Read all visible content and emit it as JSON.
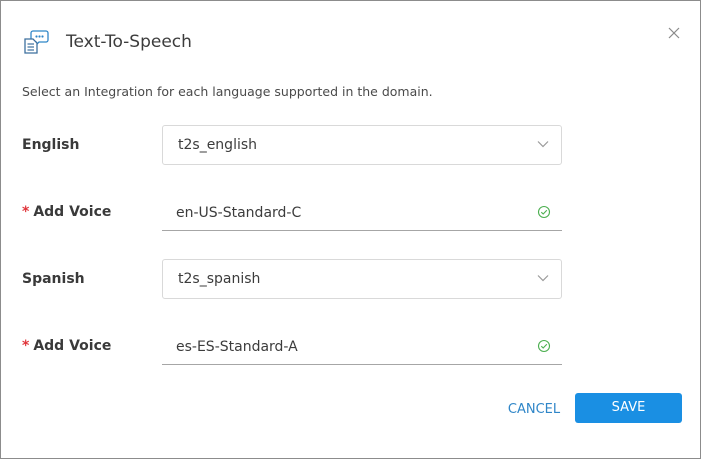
{
  "dialog": {
    "title": "Text-To-Speech",
    "subtitle": "Select an Integration for each language supported in the domain.",
    "header_icon": "speech-document-icon",
    "close_icon": "close-icon"
  },
  "languages": [
    {
      "language_label": "English",
      "integration_value": "t2s_english",
      "voice_label": "Add Voice",
      "voice_required_mark": "*",
      "voice_value": "en-US-Standard-C",
      "voice_valid": true
    },
    {
      "language_label": "Spanish",
      "integration_value": "t2s_spanish",
      "voice_label": "Add Voice",
      "voice_required_mark": "*",
      "voice_value": "es-ES-Standard-A",
      "voice_valid": true
    }
  ],
  "footer": {
    "cancel_label": "CANCEL",
    "save_label": "SAVE"
  },
  "colors": {
    "accent": "#1a8fe3",
    "link": "#2f86c8",
    "required": "#e0343a",
    "valid": "#4caf50"
  }
}
